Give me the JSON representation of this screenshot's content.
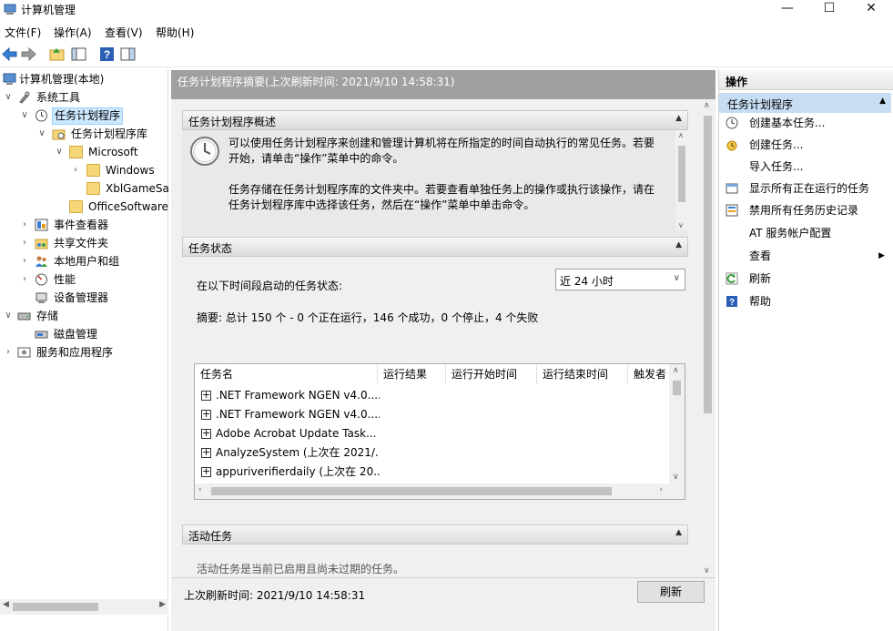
{
  "window": {
    "title": "计算机管理",
    "controls": [
      "—",
      "☐",
      "✕"
    ]
  },
  "menu": [
    "文件(F)",
    "操作(A)",
    "查看(V)",
    "帮助(H)"
  ],
  "tree": {
    "nodes": [
      {
        "label": "计算机管理(本地)",
        "icon": "computer-management-icon"
      },
      {
        "label": "系统工具",
        "icon": "system-tools-icon"
      },
      {
        "label": "任务计划程序",
        "icon": "clock-icon"
      },
      {
        "label": "任务计划程序库",
        "icon": "folder-icon"
      },
      {
        "label": "Microsoft",
        "icon": "folder-icon"
      },
      {
        "label": "Windows",
        "icon": "folder-icon"
      },
      {
        "label": "XblGameSa",
        "icon": "folder-icon"
      },
      {
        "label": "OfficeSoftware",
        "icon": "folder-icon"
      },
      {
        "label": "事件查看器",
        "icon": "event-viewer-icon"
      },
      {
        "label": "共享文件夹",
        "icon": "shared-folder-icon"
      },
      {
        "label": "本地用户和组",
        "icon": "users-icon"
      },
      {
        "label": "性能",
        "icon": "performance-icon"
      },
      {
        "label": "设备管理器",
        "icon": "device-manager-icon"
      },
      {
        "label": "存储",
        "icon": "storage-icon"
      },
      {
        "label": "磁盘管理",
        "icon": "disk-icon"
      },
      {
        "label": "服务和应用程序",
        "icon": "services-icon"
      }
    ]
  },
  "middle": {
    "header": "任务计划程序摘要(上次刷新时间: 2021/9/10 14:58:31)",
    "overview": {
      "title": "任务计划程序概述",
      "para1_line1": "可以使用任务计划程序来创建和管理计算机将在所指定的时间自动执行的常见任务。若要",
      "para1_line2": "开始，请单击“操作”菜单中的命令。",
      "para2_line1": "任务存储在任务计划程序库的文件夹中。若要查看单独任务上的操作或执行该操作，请在",
      "para2_line2": "任务计划程序库中选择该任务，然后在“操作”菜单中单击命令。"
    },
    "status": {
      "title": "任务状态",
      "period_label": "在以下时间段启动的任务状态:",
      "period_value": "近 24 小时",
      "summary": "摘要: 总计 150 个 - 0 个正在运行，146 个成功，0 个停止，4 个失败",
      "columns": [
        "任务名",
        "运行结果",
        "运行开始时间",
        "运行结束时间",
        "触发者"
      ],
      "rows": [
        ".NET Framework NGEN v4.0....",
        ".NET Framework NGEN v4.0....",
        "Adobe Acrobat Update Task...",
        "AnalyzeSystem (上次在 2021/...",
        "appuriverifierdaily (上次在 20..."
      ]
    },
    "active": {
      "title": "活动任务",
      "partial_text": "活动任务是当前已启用且尚未过期的任务。"
    },
    "footer": {
      "last_refresh": "上次刷新时间: 2021/9/10 14:58:31",
      "refresh_button": "刷新"
    }
  },
  "actions": {
    "title": "操作",
    "group": "任务计划程序",
    "items": [
      {
        "label": "创建基本任务...",
        "icon": "create-basic-task-icon"
      },
      {
        "label": "创建任务...",
        "icon": "create-task-icon"
      },
      {
        "label": "导入任务...",
        "icon": ""
      },
      {
        "label": "显示所有正在运行的任务",
        "icon": "running-tasks-icon"
      },
      {
        "label": "禁用所有任务历史记录",
        "icon": "history-icon"
      },
      {
        "label": "AT 服务帐户配置",
        "icon": ""
      },
      {
        "label": "查看",
        "icon": "",
        "submenu": "▶"
      },
      {
        "label": "刷新",
        "icon": "refresh-icon"
      },
      {
        "label": "帮助",
        "icon": "help-icon"
      }
    ]
  },
  "colors": {
    "selection": "#cce8ff",
    "header_gray": "#a0a0a0",
    "action_group": "#c6ddf3"
  }
}
